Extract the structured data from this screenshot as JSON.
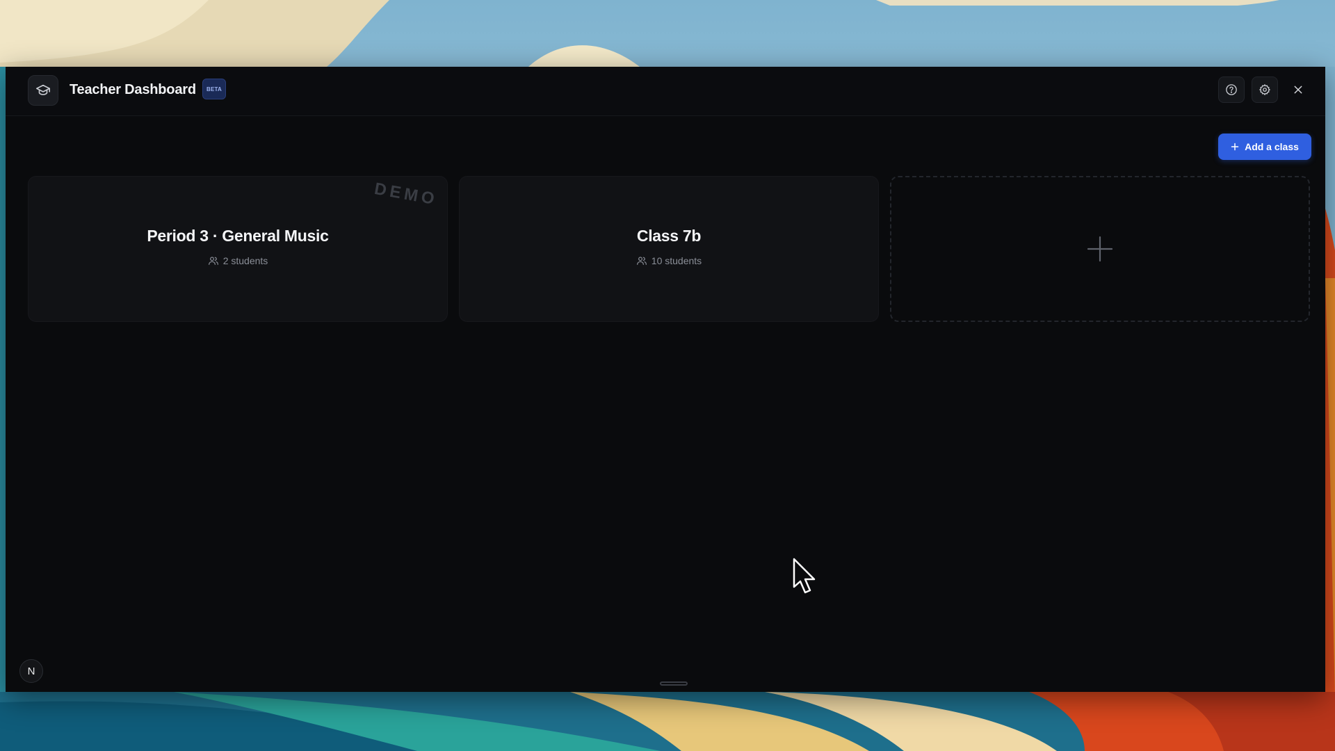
{
  "app": {
    "title": "Teacher Dashboard",
    "badge": "BETA",
    "logo_icon": "graduation-cap-icon"
  },
  "titlebar": {
    "help_icon": "help-circle-icon",
    "settings_icon": "gear-icon",
    "close_icon": "close-icon"
  },
  "toolbar": {
    "add_class_label": "Add a class",
    "add_class_icon": "plus-icon"
  },
  "classes": [
    {
      "name": "Period 3 · General Music",
      "students": "2 students",
      "stamp": "DEMO"
    },
    {
      "name": "Class 7b",
      "students": "10 students"
    }
  ],
  "add_card": {
    "icon": "plus-icon"
  },
  "user": {
    "initial": "N"
  },
  "colors": {
    "accent": "#2f5fe0",
    "window_bg": "#0a0b0d",
    "card_bg": "#111215",
    "badge_bg": "#1a2a57"
  }
}
